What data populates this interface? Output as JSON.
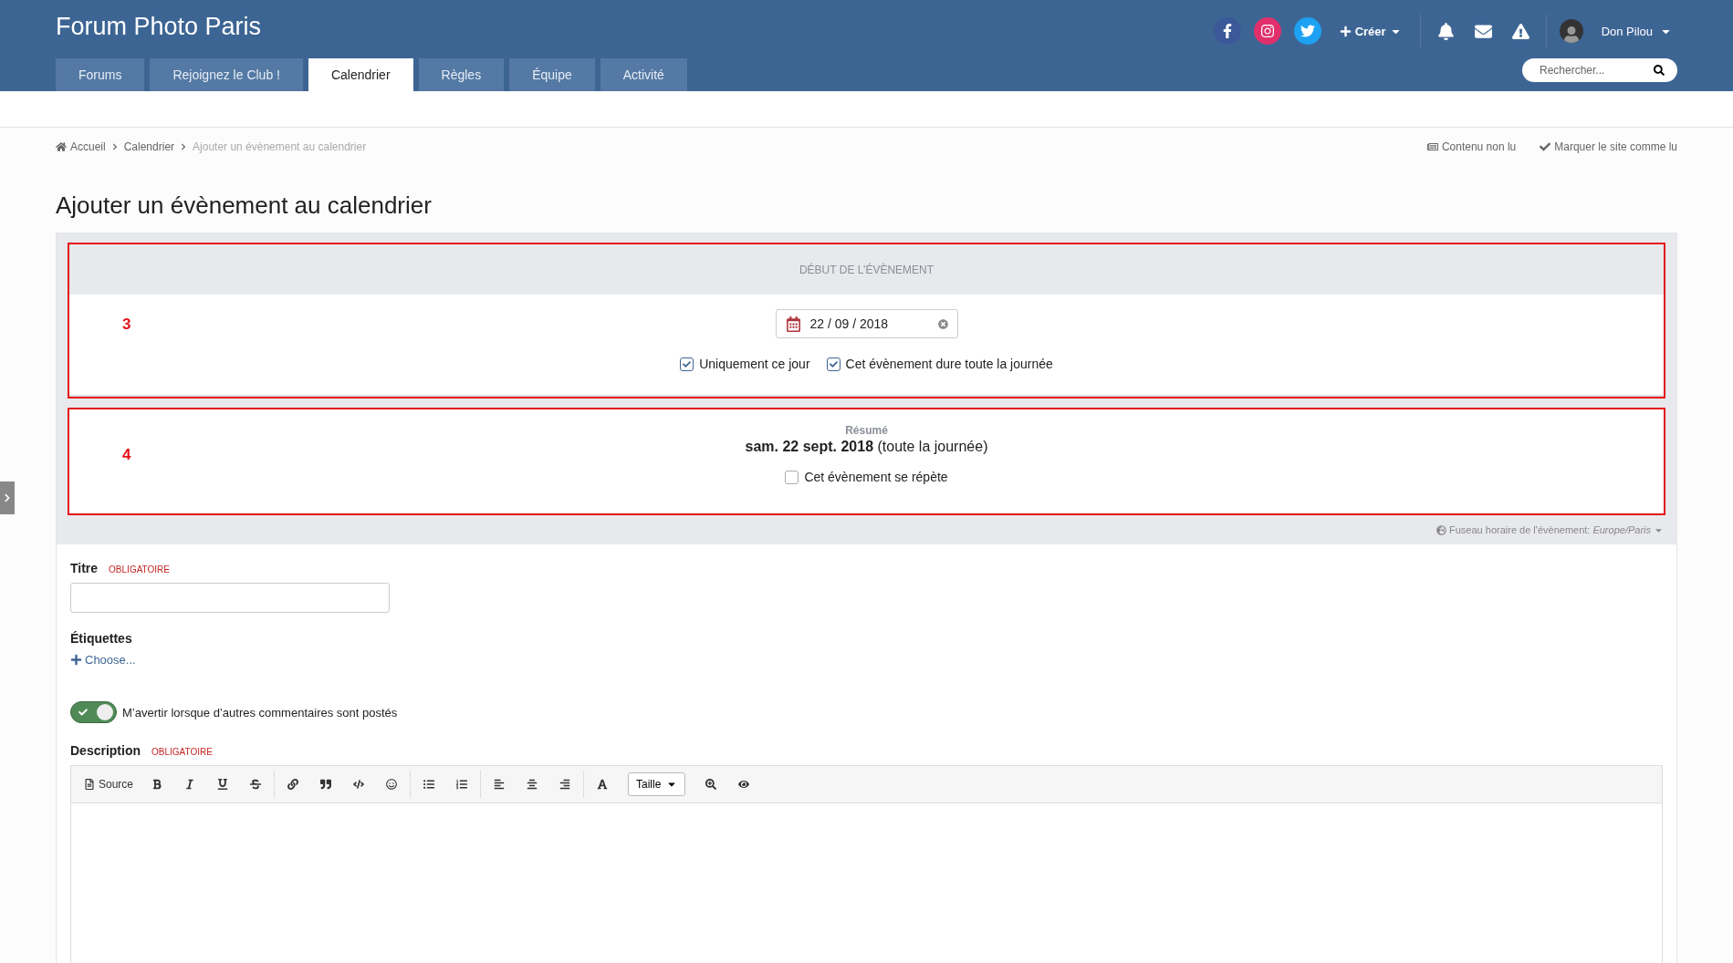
{
  "header": {
    "site_title": "Forum Photo Paris",
    "create_label": "Créer",
    "user_name": "Don Pilou",
    "search": {
      "placeholder": "Rechercher..."
    }
  },
  "tabs": [
    {
      "label": "Forums",
      "selected": false
    },
    {
      "label": "Rejoignez le Club !",
      "selected": false
    },
    {
      "label": "Calendrier",
      "selected": true
    },
    {
      "label": "Règles",
      "selected": false
    },
    {
      "label": "Équipe",
      "selected": false
    },
    {
      "label": "Activité",
      "selected": false
    }
  ],
  "breadcrumb": [
    {
      "label": "Accueil",
      "current": false
    },
    {
      "label": "Calendrier",
      "current": false
    },
    {
      "label": "Ajouter un évènement au calendrier",
      "current": true
    }
  ],
  "page_actions": [
    "Contenu non lu",
    "Marquer le site comme lu"
  ],
  "page_title": "Ajouter un évènement au calendrier",
  "start_section": {
    "marker": "3",
    "heading": "DÉBUT DE L’ÉVÈNEMENT",
    "date": "22 / 09 / 2018",
    "options": [
      {
        "label": "Uniquement ce jour",
        "checked": true
      },
      {
        "label": "Cet évènement dure toute la journée",
        "checked": true
      }
    ]
  },
  "summary_section": {
    "marker": "4",
    "heading": "Résumé",
    "summary": "**sam. 22 sept. 2018** (toute la journée)",
    "repeat": {
      "label": "Cet évènement se répète",
      "checked": false
    }
  },
  "timezone": {
    "label": "Fuseau horaire de l'évènement:",
    "value": "Europe/Paris"
  },
  "fields": {
    "title": {
      "label": "Titre",
      "required": "OBLIGATOIRE"
    },
    "tags": {
      "label": "Étiquettes",
      "action": "Choose..."
    },
    "notify": {
      "label": "M’avertir lorsque d’autres commentaires sont postés",
      "on": true
    },
    "description": {
      "label": "Description",
      "required": "OBLIGATOIRE"
    }
  },
  "editor": {
    "source_label": "Source",
    "size_label": "Taille"
  }
}
